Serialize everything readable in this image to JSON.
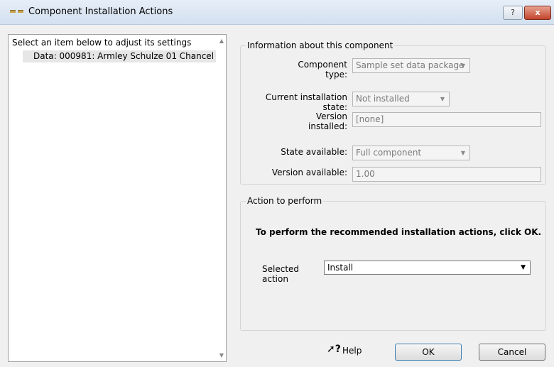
{
  "window": {
    "title": "Component Installation Actions",
    "help_label": "?",
    "close_label": "x"
  },
  "left_panel": {
    "header": "Select an item below to adjust its settings",
    "items": [
      "Data: 000981: Armley Schulze 01 Chancel"
    ]
  },
  "info": {
    "title": "Information about this component",
    "component_type_label": "Component type:",
    "component_type_value": "Sample set data package",
    "current_state_label": "Current installation state:",
    "current_state_value": "Not installed",
    "version_installed_label": "Version installed:",
    "version_installed_value": "[none]",
    "state_available_label": "State available:",
    "state_available_value": "Full component",
    "version_available_label": "Version available:",
    "version_available_value": "1.00"
  },
  "action": {
    "title": "Action to perform",
    "instruction": "To perform the recommended installation actions, click OK.",
    "selected_action_label": "Selected action",
    "selected_action_value": "Install"
  },
  "footer": {
    "help_label": "Help",
    "ok_label": "OK",
    "cancel_label": "Cancel"
  }
}
